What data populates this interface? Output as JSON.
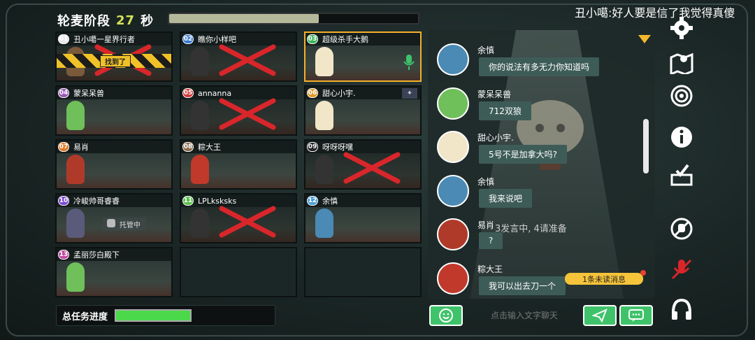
{
  "header": {
    "phase_label": "轮麦阶段",
    "seconds": "27",
    "seconds_unit": "秒",
    "timer_fraction": 0.6
  },
  "announcement": "丑小噶:好人要是信了我觉得真傻",
  "players": [
    {
      "no": "01",
      "name": "丑小噶一星界行者",
      "badge_color": "#e8e8e8",
      "eliminated": true,
      "found_label": "找到了",
      "av_color": "#7a5a3a"
    },
    {
      "no": "02",
      "name": "瞧你小样吧",
      "badge_color": "#3a7bd5",
      "eliminated": true,
      "av_color": "#333"
    },
    {
      "no": "03",
      "name": "超级杀手大鹅",
      "badge_color": "#3bb35a",
      "eliminated": false,
      "speaking": true,
      "av_color": "#f1e6c8"
    },
    {
      "no": "04",
      "name": "蒙呆呆兽",
      "badge_color": "#9b59b6",
      "eliminated": false,
      "av_color": "#6fbf5a"
    },
    {
      "no": "05",
      "name": "annanna",
      "badge_color": "#d23a3a",
      "eliminated": true,
      "av_color": "#333"
    },
    {
      "no": "06",
      "name": "甜心小宇.",
      "badge_color": "#e09a2a",
      "eliminated": false,
      "flag": "✦",
      "av_color": "#f1e6c8"
    },
    {
      "no": "07",
      "name": "易肖",
      "badge_color": "#e07a2a",
      "eliminated": false,
      "av_color": "#b03a2a"
    },
    {
      "no": "08",
      "name": "粽大王",
      "badge_color": "#8a6a4a",
      "eliminated": false,
      "av_color": "#c0392b"
    },
    {
      "no": "09",
      "name": "呀呀呀嘿",
      "badge_color": "#222",
      "eliminated": true,
      "av_color": "#333"
    },
    {
      "no": "10",
      "name": "冷峻帅哥睿睿",
      "badge_color": "#7a4ad0",
      "eliminated": false,
      "auto_label": "托管中",
      "av_color": "#5a5a7a"
    },
    {
      "no": "11",
      "name": "LPLksksks",
      "badge_color": "#5ac04a",
      "eliminated": true,
      "av_color": "#333"
    },
    {
      "no": "12",
      "name": "余慎",
      "badge_color": "#4aa0d5",
      "eliminated": false,
      "av_color": "#4a8ab5"
    },
    {
      "no": "13",
      "name": "孟丽莎白殿下",
      "badge_color": "#c04aa0",
      "eliminated": false,
      "av_color": "#6fbf5a"
    }
  ],
  "task_progress": {
    "label": "总任务进度",
    "fraction": 1.0
  },
  "chat": {
    "messages": [
      {
        "name": "余慎",
        "text": "你的说法有多无力你知道吗",
        "av_color": "#4a8ab5"
      },
      {
        "name": "蒙呆呆兽",
        "text": "712双狼",
        "av_color": "#6fbf5a"
      },
      {
        "name": "甜心小宇.",
        "text": "5号不是加拿大吗?",
        "av_color": "#f1e6c8"
      },
      {
        "name": "余慎",
        "text": "我来说吧",
        "av_color": "#4a8ab5"
      },
      {
        "name": "易肖",
        "text": "?",
        "av_color": "#b03a2a"
      },
      {
        "name": "粽大王",
        "text": "我可以出去刀一个",
        "av_color": "#c0392b"
      }
    ],
    "speaking_status": "3发言中, 4请准备",
    "unread": "1条未读消息",
    "input_placeholder": "点击输入文字聊天"
  },
  "sidebar_icons": [
    "gear-icon",
    "map-icon",
    "target-icon",
    "info-icon",
    "vote-box-icon",
    "no-hand-icon",
    "mic-off-icon",
    "headphones-icon"
  ]
}
